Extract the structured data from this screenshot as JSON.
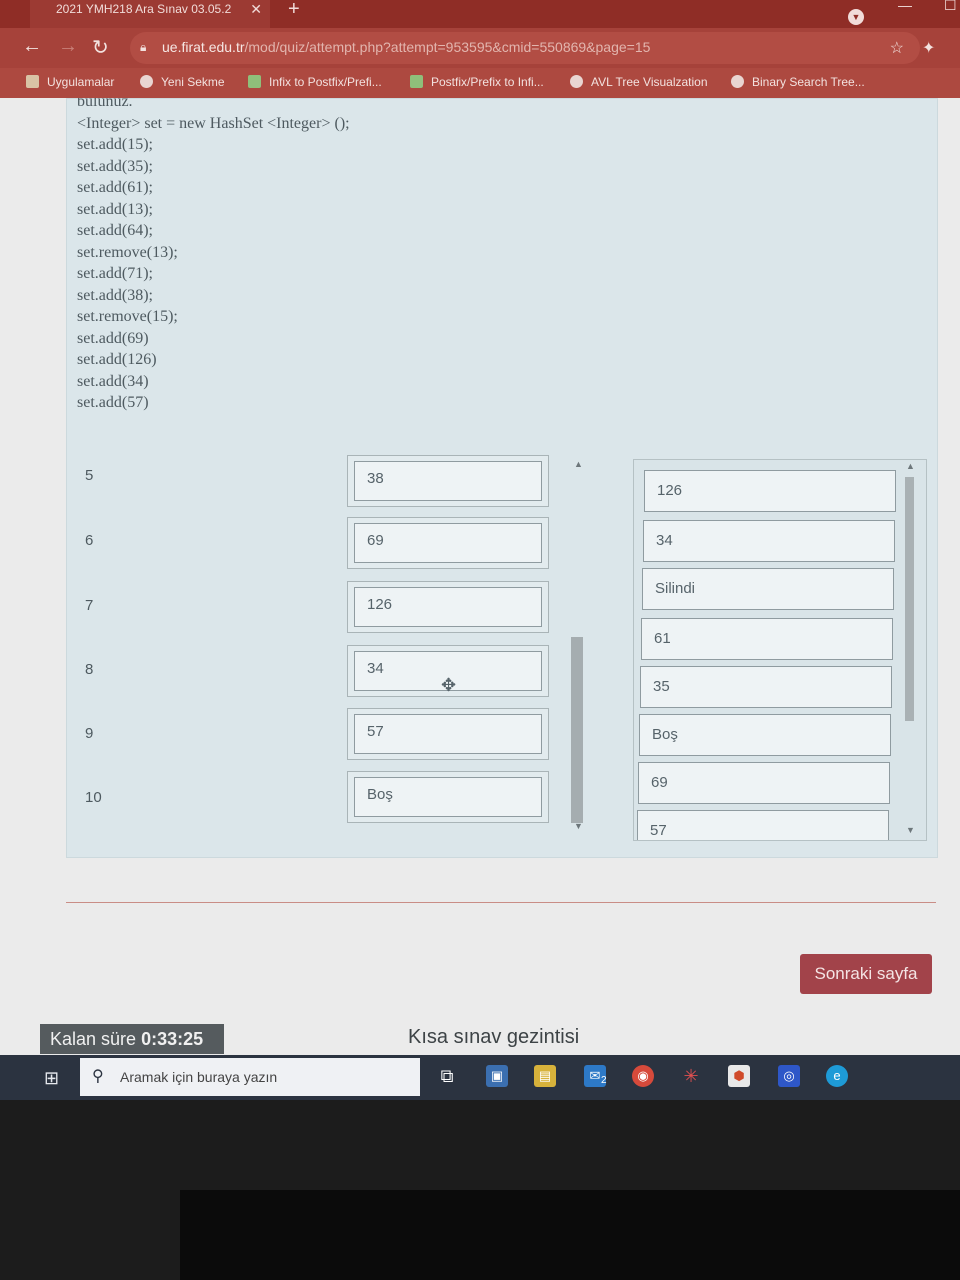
{
  "browser": {
    "tab_title": "2021 YMH218 Ara Sınav 03.05.2",
    "tab_close": "✕",
    "new_tab": "+",
    "url_host": "ue.firat.edu.tr",
    "url_rest": "/mod/quiz/attempt.php?attempt=953595&cmid=550869&page=15",
    "bookmarks": [
      "Uygulamalar",
      "Yeni Sekme",
      "Infix to Postfix/Prefi...",
      "Postfix/Prefix to Infi...",
      "AVL Tree Visualzation",
      "Binary Search Tree..."
    ]
  },
  "question": {
    "code_lines": [
      "bulunuz.",
      "<Integer> set = new HashSet <Integer> ();",
      "set.add(15);",
      "set.add(35);",
      "set.add(61);",
      "set.add(13);",
      "set.add(64);",
      "set.remove(13);",
      "set.add(71);",
      "set.add(38);",
      "set.remove(15);",
      "set.add(69)",
      "set.add(126)",
      "set.add(34)",
      "set.add(57)"
    ],
    "rows": [
      {
        "label": "5",
        "answer": "38"
      },
      {
        "label": "6",
        "answer": "69"
      },
      {
        "label": "7",
        "answer": "126"
      },
      {
        "label": "8",
        "answer": "34"
      },
      {
        "label": "9",
        "answer": "57"
      },
      {
        "label": "10",
        "answer": "Boş"
      }
    ],
    "options": [
      "126",
      "34",
      "Silindi",
      "61",
      "35",
      "Boş",
      "69",
      "57"
    ]
  },
  "footer": {
    "next_button": "Sonraki sayfa",
    "timer_label": "Kalan süre",
    "timer_value": "0:33:25",
    "quiz_nav": "Kısa sınav gezintisi"
  },
  "taskbar": {
    "search_placeholder": "Aramak için buraya yazın",
    "mail_badge": "2"
  },
  "colors": {
    "browser_frame": "#a6423a",
    "next_button": "#a2434a",
    "question_bg": "#dbe6ea",
    "taskbar": "#2b3340"
  }
}
